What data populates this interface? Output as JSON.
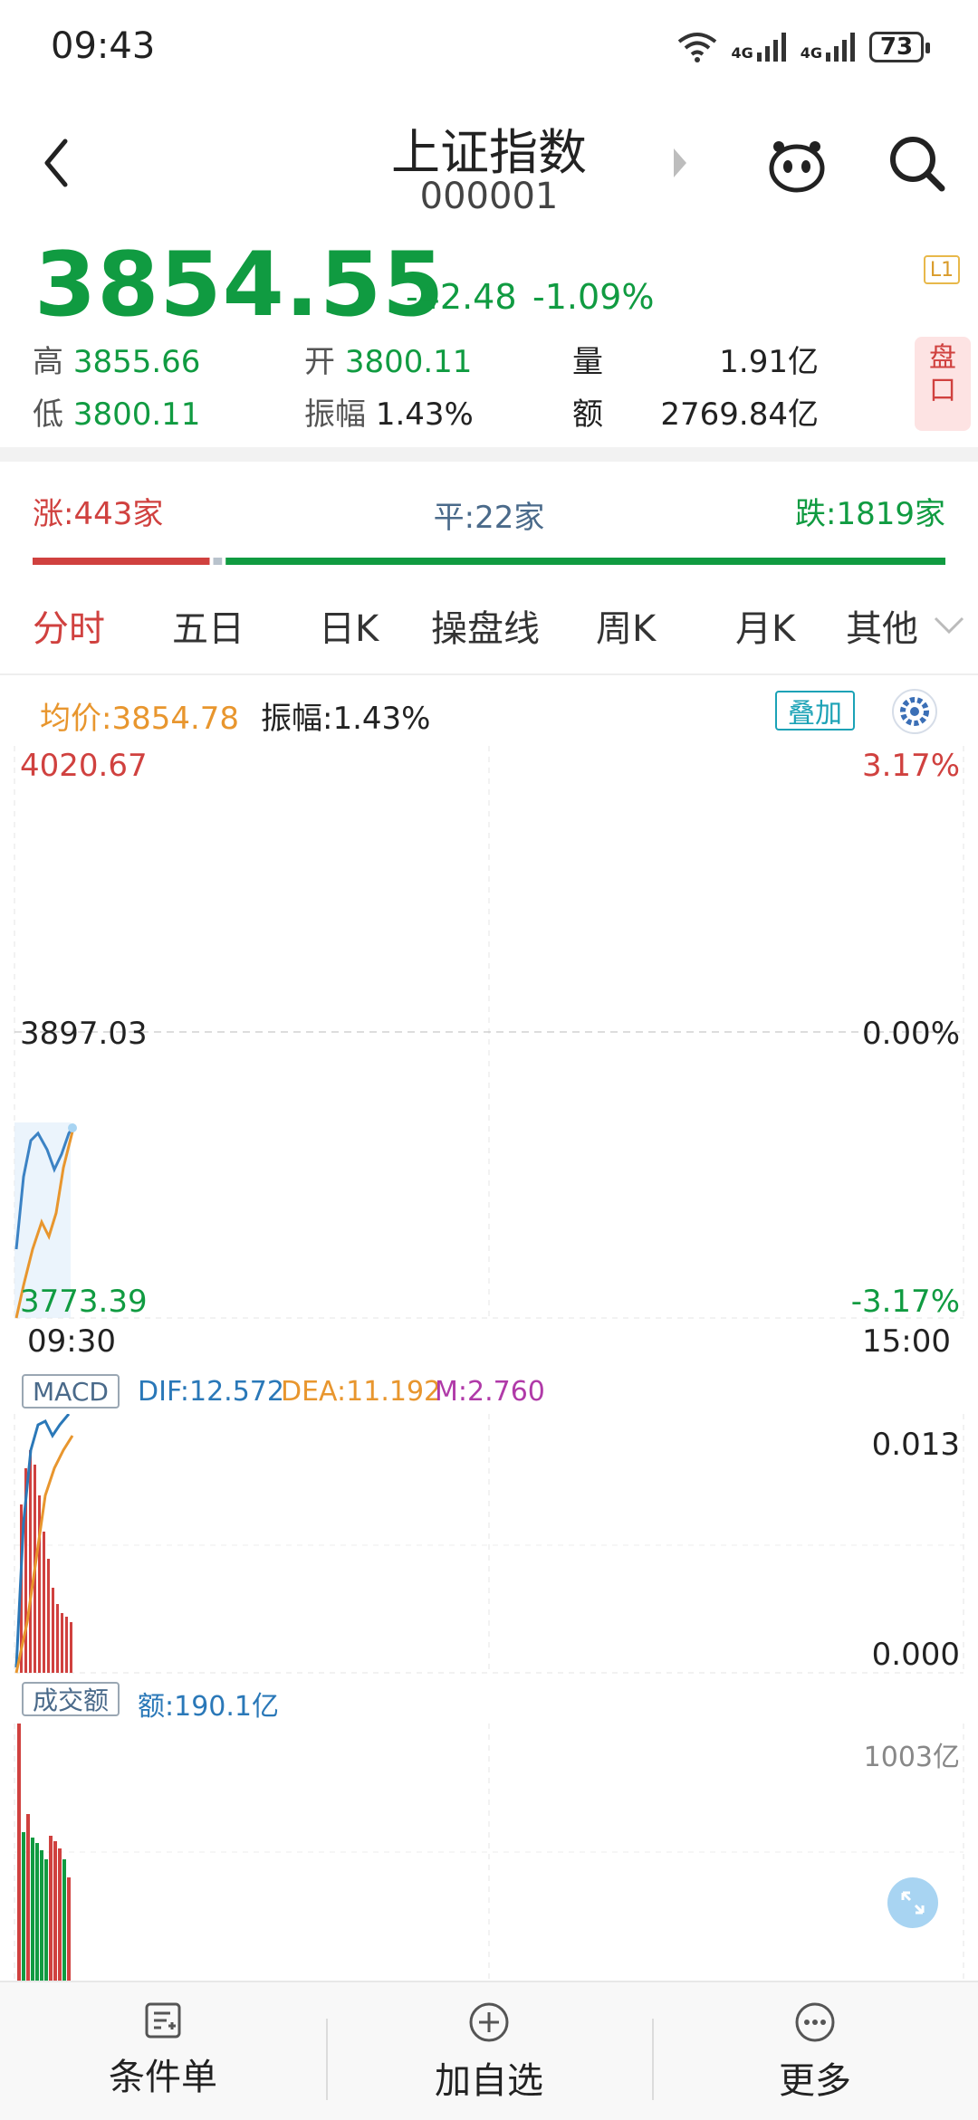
{
  "status_bar": {
    "time": "09:43",
    "net1": "4G",
    "net2": "4G",
    "battery": "73"
  },
  "header": {
    "title": "上证指数",
    "code": "000001"
  },
  "quote": {
    "price": "3854.55",
    "change": "-42.48",
    "change_pct": "-1.09%",
    "level_badge": "L1",
    "high_label": "高",
    "high": "3855.66",
    "open_label": "开",
    "open": "3800.11",
    "volume_label": "量",
    "volume": "1.91亿",
    "low_label": "低",
    "low": "3800.11",
    "amplitude_label": "振幅",
    "amplitude": "1.43%",
    "amount_label": "额",
    "amount": "2769.84亿",
    "pankou_label": "盘口"
  },
  "breadth": {
    "up": "涨:443家",
    "flat": "平:22家",
    "down": "跌:1819家",
    "up_count": 443,
    "flat_count": 22,
    "down_count": 1819
  },
  "tabs": [
    {
      "label": "分时",
      "active": true
    },
    {
      "label": "五日"
    },
    {
      "label": "日K"
    },
    {
      "label": "操盘线"
    },
    {
      "label": "周K"
    },
    {
      "label": "月K"
    },
    {
      "label": "其他"
    }
  ],
  "intraday": {
    "avg_price": "均价:3854.78",
    "amplitude": "振幅:1.43%",
    "overlay_label": "叠加",
    "y_top": "4020.67",
    "y_mid": "3897.03",
    "y_bottom": "3773.39",
    "pct_top": "3.17%",
    "pct_mid": "0.00%",
    "pct_bottom": "-3.17%",
    "time_start": "09:30",
    "time_end": "15:00"
  },
  "macd": {
    "tag": "MACD",
    "dif": "DIF:12.572",
    "dea": "DEA:11.192",
    "m": "M:2.760",
    "y_top": "0.013",
    "y_bottom": "0.000"
  },
  "turnover": {
    "tag": "成交额",
    "amount": "额:190.1亿",
    "y_top": "1003亿"
  },
  "colors": {
    "up": "#d0413f",
    "down": "#109b41",
    "avg": "#e8962e",
    "price_line": "#3b82c4",
    "dea": "#e8962e",
    "m": "#b03aa8"
  },
  "bottom_nav": [
    {
      "label": "条件单"
    },
    {
      "label": "加自选"
    },
    {
      "label": "更多"
    }
  ]
}
